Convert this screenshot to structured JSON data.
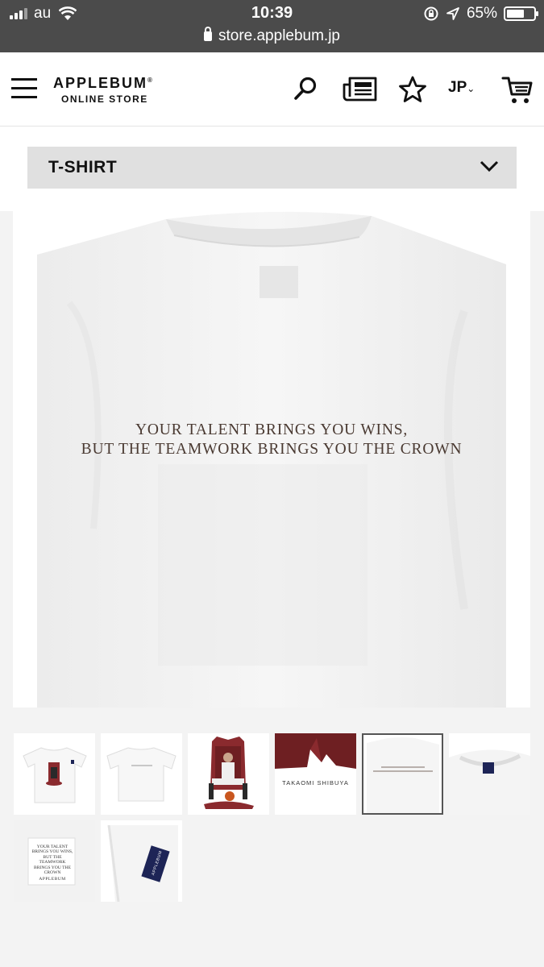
{
  "status_bar": {
    "carrier": "au",
    "time": "10:39",
    "battery_percent": "65%",
    "battery_level": 0.65,
    "url": "store.applebum.jp"
  },
  "header": {
    "brand": "APPLEBUM",
    "registered": "®",
    "subtitle": "ONLINE STORE",
    "language": "JP",
    "language_caret": "⌄"
  },
  "category": {
    "selected": "T-SHIRT"
  },
  "product": {
    "print_line1": "YOUR TALENT BRINGS YOU WINS,",
    "print_line2": "BUT THE TEAMWORK BRINGS YOU THE CROWN"
  },
  "thumbnails": {
    "active_index": 4,
    "items": [
      {
        "name": "front"
      },
      {
        "name": "back"
      },
      {
        "name": "graphic-detail"
      },
      {
        "name": "artist-credit",
        "text": "TAKAOMI SHIBUYA"
      },
      {
        "name": "back-print"
      },
      {
        "name": "collar-tag"
      },
      {
        "name": "inner-tag",
        "text": "YOUR TALENT BRINGS YOU WINS, BUT THE TEAMWORK BRINGS YOU THE CROWN",
        "brand": "APPLEBUM"
      },
      {
        "name": "sleeve-tag",
        "text": "APPLEBUM"
      }
    ]
  },
  "colors": {
    "status_bar_bg": "#4b4b4b",
    "category_bg": "#e0e0e0",
    "print_color": "#4a3a32",
    "graphic_red": "#8a2a2e",
    "tag_navy": "#1d2456"
  }
}
